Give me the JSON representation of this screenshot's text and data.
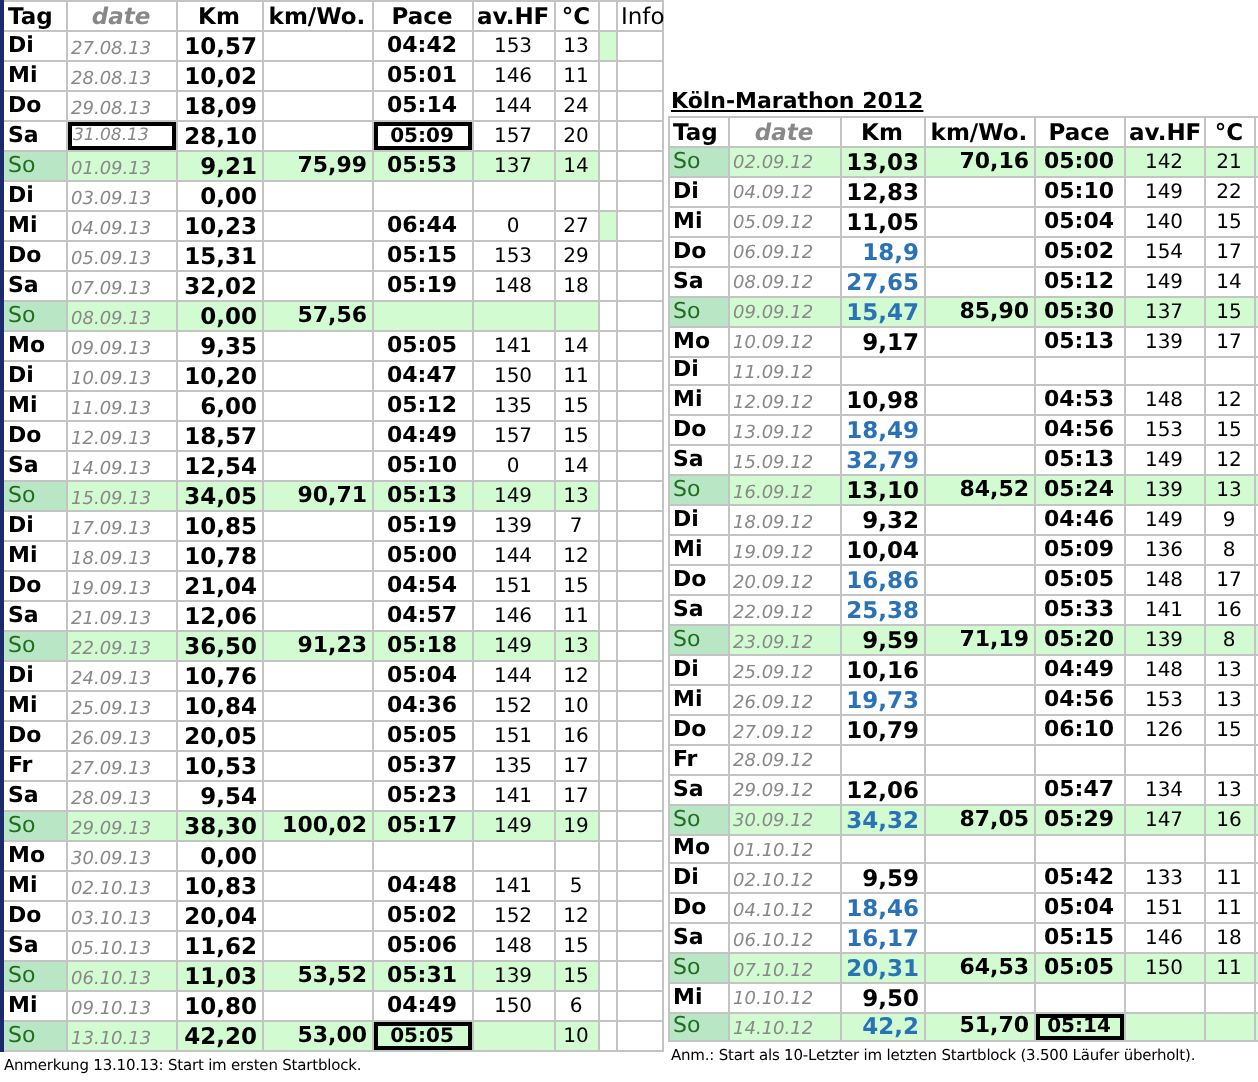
{
  "left": {
    "columns": [
      "Tag",
      "date",
      "Km",
      "km/Wo.",
      "Pace",
      "av.HF",
      "°C",
      "Info"
    ],
    "rows": [
      {
        "day": "Di",
        "date": "27.08.13",
        "km": "10,57",
        "pace": "04:42",
        "hf": "153",
        "temp": "13",
        "sunday": false,
        "flag": true,
        "date_boxed": false,
        "pace_boxed": false
      },
      {
        "day": "Mi",
        "date": "28.08.13",
        "km": "10,02",
        "pace": "05:01",
        "hf": "146",
        "temp": "11",
        "sunday": false,
        "flag": false,
        "date_boxed": false,
        "pace_boxed": false
      },
      {
        "day": "Do",
        "date": "29.08.13",
        "km": "18,09",
        "pace": "05:14",
        "hf": "144",
        "temp": "24",
        "sunday": false,
        "flag": false,
        "date_boxed": false,
        "pace_boxed": false
      },
      {
        "day": "Sa",
        "date": "31.08.13",
        "km": "28,10",
        "pace": "05:09",
        "hf": "157",
        "temp": "20",
        "sunday": false,
        "flag": false,
        "date_boxed": true,
        "pace_boxed": true
      },
      {
        "day": "So",
        "date": "01.09.13",
        "km": "9,21",
        "week_km": "75,99",
        "pace": "05:53",
        "hf": "137",
        "temp": "14",
        "sunday": true,
        "flag": false,
        "date_boxed": false,
        "pace_boxed": false
      },
      {
        "day": "Di",
        "date": "03.09.13",
        "km": "0,00",
        "sunday": false,
        "flag": false,
        "date_boxed": false,
        "pace_boxed": false
      },
      {
        "day": "Mi",
        "date": "04.09.13",
        "km": "10,23",
        "pace": "06:44",
        "hf": "0",
        "temp": "27",
        "sunday": false,
        "flag": true,
        "date_boxed": false,
        "pace_boxed": false
      },
      {
        "day": "Do",
        "date": "05.09.13",
        "km": "15,31",
        "pace": "05:15",
        "hf": "153",
        "temp": "29",
        "sunday": false,
        "flag": false,
        "date_boxed": false,
        "pace_boxed": false
      },
      {
        "day": "Sa",
        "date": "07.09.13",
        "km": "32,02",
        "pace": "05:19",
        "hf": "148",
        "temp": "18",
        "sunday": false,
        "flag": false,
        "date_boxed": false,
        "pace_boxed": false
      },
      {
        "day": "So",
        "date": "08.09.13",
        "km": "0,00",
        "week_km": "57,56",
        "sunday": true,
        "flag": false,
        "date_boxed": false,
        "pace_boxed": false
      },
      {
        "day": "Mo",
        "date": "09.09.13",
        "km": "9,35",
        "pace": "05:05",
        "hf": "141",
        "temp": "14",
        "sunday": false,
        "flag": false,
        "date_boxed": false,
        "pace_boxed": false
      },
      {
        "day": "Di",
        "date": "10.09.13",
        "km": "10,20",
        "pace": "04:47",
        "hf": "150",
        "temp": "11",
        "sunday": false,
        "flag": false,
        "date_boxed": false,
        "pace_boxed": false
      },
      {
        "day": "Mi",
        "date": "11.09.13",
        "km": "6,00",
        "pace": "05:12",
        "hf": "135",
        "temp": "15",
        "sunday": false,
        "flag": false,
        "date_boxed": false,
        "pace_boxed": false
      },
      {
        "day": "Do",
        "date": "12.09.13",
        "km": "18,57",
        "pace": "04:49",
        "hf": "157",
        "temp": "15",
        "sunday": false,
        "flag": false,
        "date_boxed": false,
        "pace_boxed": false
      },
      {
        "day": "Sa",
        "date": "14.09.13",
        "km": "12,54",
        "pace": "05:10",
        "hf": "0",
        "temp": "14",
        "sunday": false,
        "flag": false,
        "date_boxed": false,
        "pace_boxed": false
      },
      {
        "day": "So",
        "date": "15.09.13",
        "km": "34,05",
        "week_km": "90,71",
        "pace": "05:13",
        "hf": "149",
        "temp": "13",
        "sunday": true,
        "flag": false,
        "date_boxed": false,
        "pace_boxed": false
      },
      {
        "day": "Di",
        "date": "17.09.13",
        "km": "10,85",
        "pace": "05:19",
        "hf": "139",
        "temp": "7",
        "sunday": false,
        "flag": false,
        "date_boxed": false,
        "pace_boxed": false
      },
      {
        "day": "Mi",
        "date": "18.09.13",
        "km": "10,78",
        "pace": "05:00",
        "hf": "144",
        "temp": "12",
        "sunday": false,
        "flag": false,
        "date_boxed": false,
        "pace_boxed": false
      },
      {
        "day": "Do",
        "date": "19.09.13",
        "km": "21,04",
        "pace": "04:54",
        "hf": "151",
        "temp": "15",
        "sunday": false,
        "flag": false,
        "date_boxed": false,
        "pace_boxed": false
      },
      {
        "day": "Sa",
        "date": "21.09.13",
        "km": "12,06",
        "pace": "04:57",
        "hf": "146",
        "temp": "11",
        "sunday": false,
        "flag": false,
        "date_boxed": false,
        "pace_boxed": false
      },
      {
        "day": "So",
        "date": "22.09.13",
        "km": "36,50",
        "week_km": "91,23",
        "pace": "05:18",
        "hf": "149",
        "temp": "13",
        "sunday": true,
        "flag": false,
        "date_boxed": false,
        "pace_boxed": false
      },
      {
        "day": "Di",
        "date": "24.09.13",
        "km": "10,76",
        "pace": "05:04",
        "hf": "144",
        "temp": "12",
        "sunday": false,
        "flag": false,
        "date_boxed": false,
        "pace_boxed": false
      },
      {
        "day": "Mi",
        "date": "25.09.13",
        "km": "10,84",
        "pace": "04:36",
        "hf": "152",
        "temp": "10",
        "sunday": false,
        "flag": false,
        "date_boxed": false,
        "pace_boxed": false
      },
      {
        "day": "Do",
        "date": "26.09.13",
        "km": "20,05",
        "pace": "05:05",
        "hf": "151",
        "temp": "16",
        "sunday": false,
        "flag": false,
        "date_boxed": false,
        "pace_boxed": false
      },
      {
        "day": "Fr",
        "date": "27.09.13",
        "km": "10,53",
        "pace": "05:37",
        "hf": "135",
        "temp": "17",
        "sunday": false,
        "flag": false,
        "date_boxed": false,
        "pace_boxed": false
      },
      {
        "day": "Sa",
        "date": "28.09.13",
        "km": "9,54",
        "pace": "05:23",
        "hf": "141",
        "temp": "17",
        "sunday": false,
        "flag": false,
        "date_boxed": false,
        "pace_boxed": false
      },
      {
        "day": "So",
        "date": "29.09.13",
        "km": "38,30",
        "week_km": "100,02",
        "pace": "05:17",
        "hf": "149",
        "temp": "19",
        "sunday": true,
        "flag": false,
        "date_boxed": false,
        "pace_boxed": false
      },
      {
        "day": "Mo",
        "date": "30.09.13",
        "km": "0,00",
        "sunday": false,
        "flag": false,
        "date_boxed": false,
        "pace_boxed": false
      },
      {
        "day": "Mi",
        "date": "02.10.13",
        "km": "10,83",
        "pace": "04:48",
        "hf": "141",
        "temp": "5",
        "sunday": false,
        "flag": false,
        "date_boxed": false,
        "pace_boxed": false
      },
      {
        "day": "Do",
        "date": "03.10.13",
        "km": "20,04",
        "pace": "05:02",
        "hf": "152",
        "temp": "12",
        "sunday": false,
        "flag": false,
        "date_boxed": false,
        "pace_boxed": false
      },
      {
        "day": "Sa",
        "date": "05.10.13",
        "km": "11,62",
        "pace": "05:06",
        "hf": "148",
        "temp": "15",
        "sunday": false,
        "flag": false,
        "date_boxed": false,
        "pace_boxed": false
      },
      {
        "day": "So",
        "date": "06.10.13",
        "km": "11,03",
        "week_km": "53,52",
        "pace": "05:31",
        "hf": "139",
        "temp": "15",
        "sunday": true,
        "flag": false,
        "date_boxed": false,
        "pace_boxed": false
      },
      {
        "day": "Mi",
        "date": "09.10.13",
        "km": "10,80",
        "pace": "04:49",
        "hf": "150",
        "temp": "6",
        "sunday": false,
        "flag": false,
        "date_boxed": false,
        "pace_boxed": false
      },
      {
        "day": "So",
        "date": "13.10.13",
        "km": "42,20",
        "week_km": "53,00",
        "pace": "05:05",
        "temp": "10",
        "sunday": true,
        "flag": false,
        "date_boxed": false,
        "pace_boxed": true
      }
    ],
    "note": "Anmerkung 13.10.13: Start im ersten Startblock."
  },
  "right": {
    "title": "Köln-Marathon 2012",
    "columns": [
      "Tag",
      "date",
      "Km",
      "km/Wo.",
      "Pace",
      "av.HF",
      "°C"
    ],
    "rows": [
      {
        "day": "So",
        "date": "02.09.12",
        "km": "13,03",
        "week_km": "70,16",
        "pace": "05:00",
        "hf": "142",
        "temp": "21",
        "sunday": true,
        "km_highlight": false,
        "pace_boxed": false
      },
      {
        "day": "Di",
        "date": "04.09.12",
        "km": "12,83",
        "pace": "05:10",
        "hf": "149",
        "temp": "22",
        "sunday": false,
        "km_highlight": false,
        "pace_boxed": false
      },
      {
        "day": "Mi",
        "date": "05.09.12",
        "km": "11,05",
        "pace": "05:04",
        "hf": "140",
        "temp": "15",
        "sunday": false,
        "km_highlight": false,
        "pace_boxed": false
      },
      {
        "day": "Do",
        "date": "06.09.12",
        "km": "18,9",
        "pace": "05:02",
        "hf": "154",
        "temp": "17",
        "sunday": false,
        "km_highlight": true,
        "pace_boxed": false
      },
      {
        "day": "Sa",
        "date": "08.09.12",
        "km": "27,65",
        "pace": "05:12",
        "hf": "149",
        "temp": "14",
        "sunday": false,
        "km_highlight": true,
        "pace_boxed": false
      },
      {
        "day": "So",
        "date": "09.09.12",
        "km": "15,47",
        "week_km": "85,90",
        "pace": "05:30",
        "hf": "137",
        "temp": "15",
        "sunday": true,
        "km_highlight": true,
        "pace_boxed": false
      },
      {
        "day": "Mo",
        "date": "10.09.12",
        "km": "9,17",
        "pace": "05:13",
        "hf": "139",
        "temp": "17",
        "sunday": false,
        "km_highlight": false,
        "pace_boxed": false
      },
      {
        "day": "Di",
        "date": "11.09.12",
        "sunday": false,
        "km_highlight": false,
        "pace_boxed": false
      },
      {
        "day": "Mi",
        "date": "12.09.12",
        "km": "10,98",
        "pace": "04:53",
        "hf": "148",
        "temp": "12",
        "sunday": false,
        "km_highlight": false,
        "pace_boxed": false
      },
      {
        "day": "Do",
        "date": "13.09.12",
        "km": "18,49",
        "pace": "04:56",
        "hf": "153",
        "temp": "15",
        "sunday": false,
        "km_highlight": true,
        "pace_boxed": false
      },
      {
        "day": "Sa",
        "date": "15.09.12",
        "km": "32,79",
        "pace": "05:13",
        "hf": "149",
        "temp": "12",
        "sunday": false,
        "km_highlight": true,
        "pace_boxed": false
      },
      {
        "day": "So",
        "date": "16.09.12",
        "km": "13,10",
        "week_km": "84,52",
        "pace": "05:24",
        "hf": "139",
        "temp": "13",
        "sunday": true,
        "km_highlight": false,
        "pace_boxed": false
      },
      {
        "day": "Di",
        "date": "18.09.12",
        "km": "9,32",
        "pace": "04:46",
        "hf": "149",
        "temp": "9",
        "sunday": false,
        "km_highlight": false,
        "pace_boxed": false
      },
      {
        "day": "Mi",
        "date": "19.09.12",
        "km": "10,04",
        "pace": "05:09",
        "hf": "136",
        "temp": "8",
        "sunday": false,
        "km_highlight": false,
        "pace_boxed": false
      },
      {
        "day": "Do",
        "date": "20.09.12",
        "km": "16,86",
        "pace": "05:05",
        "hf": "148",
        "temp": "17",
        "sunday": false,
        "km_highlight": true,
        "pace_boxed": false
      },
      {
        "day": "Sa",
        "date": "22.09.12",
        "km": "25,38",
        "pace": "05:33",
        "hf": "141",
        "temp": "16",
        "sunday": false,
        "km_highlight": true,
        "pace_boxed": false
      },
      {
        "day": "So",
        "date": "23.09.12",
        "km": "9,59",
        "week_km": "71,19",
        "pace": "05:20",
        "hf": "139",
        "temp": "8",
        "sunday": true,
        "km_highlight": false,
        "pace_boxed": false
      },
      {
        "day": "Di",
        "date": "25.09.12",
        "km": "10,16",
        "pace": "04:49",
        "hf": "148",
        "temp": "13",
        "sunday": false,
        "km_highlight": false,
        "pace_boxed": false
      },
      {
        "day": "Mi",
        "date": "26.09.12",
        "km": "19,73",
        "pace": "04:56",
        "hf": "153",
        "temp": "13",
        "sunday": false,
        "km_highlight": true,
        "pace_boxed": false
      },
      {
        "day": "Do",
        "date": "27.09.12",
        "km": "10,79",
        "pace": "06:10",
        "hf": "126",
        "temp": "15",
        "sunday": false,
        "km_highlight": false,
        "pace_boxed": false
      },
      {
        "day": "Fr",
        "date": "28.09.12",
        "sunday": false,
        "km_highlight": false,
        "pace_boxed": false
      },
      {
        "day": "Sa",
        "date": "29.09.12",
        "km": "12,06",
        "pace": "05:47",
        "hf": "134",
        "temp": "13",
        "sunday": false,
        "km_highlight": false,
        "pace_boxed": false
      },
      {
        "day": "So",
        "date": "30.09.12",
        "km": "34,32",
        "week_km": "87,05",
        "pace": "05:29",
        "hf": "147",
        "temp": "16",
        "sunday": true,
        "km_highlight": true,
        "pace_boxed": false
      },
      {
        "day": "Mo",
        "date": "01.10.12",
        "sunday": false,
        "km_highlight": false,
        "pace_boxed": false
      },
      {
        "day": "Di",
        "date": "02.10.12",
        "km": "9,59",
        "pace": "05:42",
        "hf": "133",
        "temp": "11",
        "sunday": false,
        "km_highlight": false,
        "pace_boxed": false
      },
      {
        "day": "Do",
        "date": "04.10.12",
        "km": "18,46",
        "pace": "05:04",
        "hf": "151",
        "temp": "11",
        "sunday": false,
        "km_highlight": true,
        "pace_boxed": false
      },
      {
        "day": "Sa",
        "date": "06.10.12",
        "km": "16,17",
        "pace": "05:15",
        "hf": "146",
        "temp": "18",
        "sunday": false,
        "km_highlight": true,
        "pace_boxed": false
      },
      {
        "day": "So",
        "date": "07.10.12",
        "km": "20,31",
        "week_km": "64,53",
        "pace": "05:05",
        "hf": "150",
        "temp": "11",
        "sunday": true,
        "km_highlight": true,
        "pace_boxed": false
      },
      {
        "day": "Mi",
        "date": "10.10.12",
        "km": "9,50",
        "sunday": false,
        "km_highlight": false,
        "pace_boxed": false
      },
      {
        "day": "So",
        "date": "14.10.12",
        "km": "42,2",
        "week_km": "51,70",
        "pace": "05:14",
        "sunday": true,
        "km_highlight": true,
        "pace_boxed": true
      }
    ],
    "note": "Anm.: Start als 10-Letzter im letzten Startblock (3.500 Läufer überholt)."
  }
}
